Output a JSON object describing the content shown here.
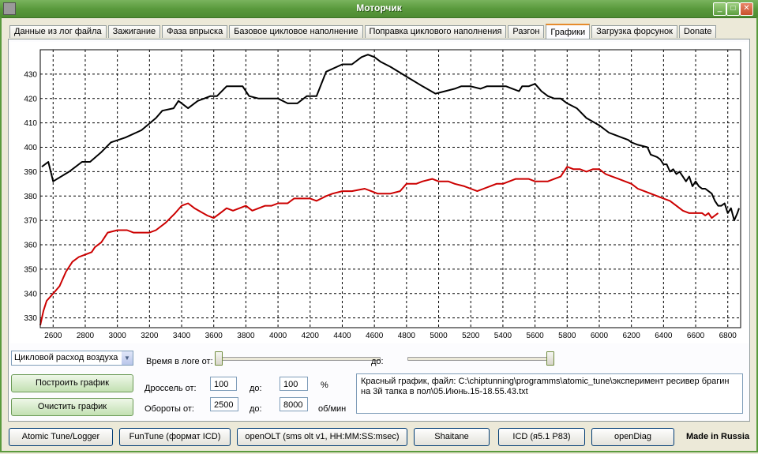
{
  "window": {
    "title": "Моторчик",
    "minimize": "_",
    "maximize": "□",
    "close": "✕"
  },
  "tabs": [
    {
      "label": "Данные из лог файла",
      "active": false
    },
    {
      "label": "Зажигание",
      "active": false
    },
    {
      "label": "Фаза впрыска",
      "active": false
    },
    {
      "label": "Базовое цикловое наполнение",
      "active": false
    },
    {
      "label": "Поправка циклового наполнения",
      "active": false
    },
    {
      "label": "Разгон",
      "active": false
    },
    {
      "label": "Графики",
      "active": true
    },
    {
      "label": "Загрузка форсунок",
      "active": false
    },
    {
      "label": "Donate",
      "active": false
    }
  ],
  "chart_data": {
    "type": "line",
    "title": "",
    "xlabel": "",
    "ylabel": "",
    "xlim": [
      2520,
      6880
    ],
    "ylim": [
      326,
      440
    ],
    "x_ticks": [
      2600,
      2800,
      3000,
      3200,
      3400,
      3600,
      3800,
      4000,
      4200,
      4400,
      4600,
      4800,
      5000,
      5200,
      5400,
      5600,
      5800,
      6000,
      6200,
      6400,
      6600,
      6800
    ],
    "y_ticks": [
      330,
      340,
      350,
      360,
      370,
      380,
      390,
      400,
      410,
      420,
      430
    ],
    "grid": true,
    "series": [
      {
        "color": "#000000",
        "points": [
          [
            2530,
            392
          ],
          [
            2570,
            394
          ],
          [
            2600,
            386
          ],
          [
            2700,
            390
          ],
          [
            2780,
            394
          ],
          [
            2830,
            394
          ],
          [
            2900,
            398
          ],
          [
            2960,
            402
          ],
          [
            3050,
            404
          ],
          [
            3150,
            407
          ],
          [
            3240,
            412
          ],
          [
            3280,
            415
          ],
          [
            3350,
            416
          ],
          [
            3380,
            419
          ],
          [
            3440,
            416
          ],
          [
            3500,
            419
          ],
          [
            3540,
            420
          ],
          [
            3580,
            421
          ],
          [
            3620,
            421
          ],
          [
            3680,
            425
          ],
          [
            3780,
            425
          ],
          [
            3820,
            421
          ],
          [
            3880,
            420
          ],
          [
            4000,
            420
          ],
          [
            4060,
            418
          ],
          [
            4120,
            418
          ],
          [
            4180,
            421
          ],
          [
            4240,
            421
          ],
          [
            4300,
            431
          ],
          [
            4400,
            434
          ],
          [
            4460,
            434
          ],
          [
            4520,
            437
          ],
          [
            4560,
            438
          ],
          [
            4600,
            437
          ],
          [
            4640,
            435
          ],
          [
            4700,
            433
          ],
          [
            4800,
            429
          ],
          [
            4900,
            425
          ],
          [
            4980,
            422
          ],
          [
            5040,
            423
          ],
          [
            5100,
            424
          ],
          [
            5140,
            425
          ],
          [
            5200,
            425
          ],
          [
            5260,
            424
          ],
          [
            5300,
            425
          ],
          [
            5360,
            425
          ],
          [
            5420,
            425
          ],
          [
            5460,
            424
          ],
          [
            5500,
            423
          ],
          [
            5520,
            425
          ],
          [
            5560,
            425
          ],
          [
            5600,
            426
          ],
          [
            5640,
            423
          ],
          [
            5680,
            421
          ],
          [
            5720,
            420
          ],
          [
            5740,
            420
          ],
          [
            5760,
            420
          ],
          [
            5800,
            418
          ],
          [
            5860,
            416
          ],
          [
            5920,
            412
          ],
          [
            6000,
            409
          ],
          [
            6060,
            406
          ],
          [
            6100,
            405
          ],
          [
            6140,
            404
          ],
          [
            6180,
            403
          ],
          [
            6200,
            402
          ],
          [
            6240,
            401
          ],
          [
            6300,
            400
          ],
          [
            6320,
            397
          ],
          [
            6360,
            396
          ],
          [
            6380,
            395
          ],
          [
            6400,
            393
          ],
          [
            6420,
            393
          ],
          [
            6440,
            390
          ],
          [
            6460,
            391
          ],
          [
            6480,
            389
          ],
          [
            6500,
            390
          ],
          [
            6520,
            388
          ],
          [
            6540,
            386
          ],
          [
            6560,
            388
          ],
          [
            6580,
            384
          ],
          [
            6600,
            386
          ],
          [
            6620,
            384
          ],
          [
            6640,
            383
          ],
          [
            6660,
            383
          ],
          [
            6680,
            382
          ],
          [
            6700,
            381
          ],
          [
            6720,
            378
          ],
          [
            6740,
            376
          ],
          [
            6760,
            376
          ],
          [
            6780,
            377
          ],
          [
            6800,
            373
          ],
          [
            6820,
            375
          ],
          [
            6840,
            370
          ],
          [
            6860,
            373
          ],
          [
            6870,
            375
          ]
        ]
      },
      {
        "color": "#cc0000",
        "points": [
          [
            2520,
            327
          ],
          [
            2540,
            333
          ],
          [
            2560,
            337
          ],
          [
            2600,
            340
          ],
          [
            2640,
            343
          ],
          [
            2680,
            349
          ],
          [
            2720,
            353
          ],
          [
            2760,
            355
          ],
          [
            2800,
            356
          ],
          [
            2840,
            357
          ],
          [
            2860,
            359
          ],
          [
            2900,
            361
          ],
          [
            2940,
            365
          ],
          [
            3000,
            366
          ],
          [
            3060,
            366
          ],
          [
            3100,
            365
          ],
          [
            3140,
            365
          ],
          [
            3200,
            365
          ],
          [
            3240,
            366
          ],
          [
            3300,
            369
          ],
          [
            3360,
            373
          ],
          [
            3400,
            376
          ],
          [
            3440,
            377
          ],
          [
            3480,
            375
          ],
          [
            3560,
            372
          ],
          [
            3600,
            371
          ],
          [
            3640,
            373
          ],
          [
            3680,
            375
          ],
          [
            3720,
            374
          ],
          [
            3760,
            375
          ],
          [
            3800,
            376
          ],
          [
            3840,
            374
          ],
          [
            3880,
            375
          ],
          [
            3920,
            376
          ],
          [
            3960,
            376
          ],
          [
            4000,
            377
          ],
          [
            4060,
            377
          ],
          [
            4100,
            379
          ],
          [
            4140,
            379
          ],
          [
            4200,
            379
          ],
          [
            4240,
            378
          ],
          [
            4300,
            380
          ],
          [
            4340,
            381
          ],
          [
            4400,
            382
          ],
          [
            4460,
            382
          ],
          [
            4540,
            383
          ],
          [
            4580,
            382
          ],
          [
            4620,
            381
          ],
          [
            4660,
            381
          ],
          [
            4700,
            381
          ],
          [
            4760,
            382
          ],
          [
            4800,
            385
          ],
          [
            4860,
            385
          ],
          [
            4900,
            386
          ],
          [
            4960,
            387
          ],
          [
            5000,
            386
          ],
          [
            5060,
            386
          ],
          [
            5100,
            385
          ],
          [
            5160,
            384
          ],
          [
            5200,
            383
          ],
          [
            5240,
            382
          ],
          [
            5280,
            383
          ],
          [
            5320,
            384
          ],
          [
            5360,
            385
          ],
          [
            5400,
            385
          ],
          [
            5440,
            386
          ],
          [
            5480,
            387
          ],
          [
            5520,
            387
          ],
          [
            5560,
            387
          ],
          [
            5600,
            386
          ],
          [
            5640,
            386
          ],
          [
            5680,
            386
          ],
          [
            5720,
            387
          ],
          [
            5760,
            388
          ],
          [
            5800,
            392
          ],
          [
            5840,
            391
          ],
          [
            5880,
            391
          ],
          [
            5920,
            390
          ],
          [
            5960,
            391
          ],
          [
            6000,
            391
          ],
          [
            6040,
            389
          ],
          [
            6080,
            388
          ],
          [
            6120,
            387
          ],
          [
            6160,
            386
          ],
          [
            6200,
            385
          ],
          [
            6240,
            383
          ],
          [
            6280,
            382
          ],
          [
            6320,
            381
          ],
          [
            6360,
            380
          ],
          [
            6400,
            379
          ],
          [
            6440,
            378
          ],
          [
            6480,
            376
          ],
          [
            6520,
            374
          ],
          [
            6560,
            373
          ],
          [
            6600,
            373
          ],
          [
            6640,
            373
          ],
          [
            6660,
            372
          ],
          [
            6680,
            373
          ],
          [
            6700,
            371
          ],
          [
            6720,
            372
          ],
          [
            6740,
            373
          ]
        ]
      }
    ]
  },
  "controls": {
    "param_select": "Цикловой расход воздуха",
    "time_from_label": "Время в логе от:",
    "time_to_label": "до:",
    "time_from_pos": 0.0,
    "time_to_pos": 1.0,
    "build_button": "Построить график",
    "clear_button": "Очистить график",
    "throttle_label": "Дроссель от:",
    "throttle_from": "100",
    "throttle_to_label": "до:",
    "throttle_to": "100",
    "throttle_unit": "%",
    "rpm_label": "Обороты от:",
    "rpm_from": "2500",
    "rpm_to_label": "до:",
    "rpm_to": "8000",
    "rpm_unit": "об/мин",
    "info_text": "Красный график, файл: C:\\chiptunning\\programms\\atomic_tune\\эксперимент ресивер брагин на 3й тапка в пол\\05.Июнь.15-18.55.43.txt"
  },
  "bottom_buttons": [
    "Atomic Tune/Logger",
    "FunTune (формат ICD)",
    "openOLT (sms olt v1, HH:MM:SS:msec)",
    "Shaitane",
    "ICD (я5.1 P83)",
    "openDiag"
  ],
  "footer": {
    "made_in": "Made in Russia"
  }
}
